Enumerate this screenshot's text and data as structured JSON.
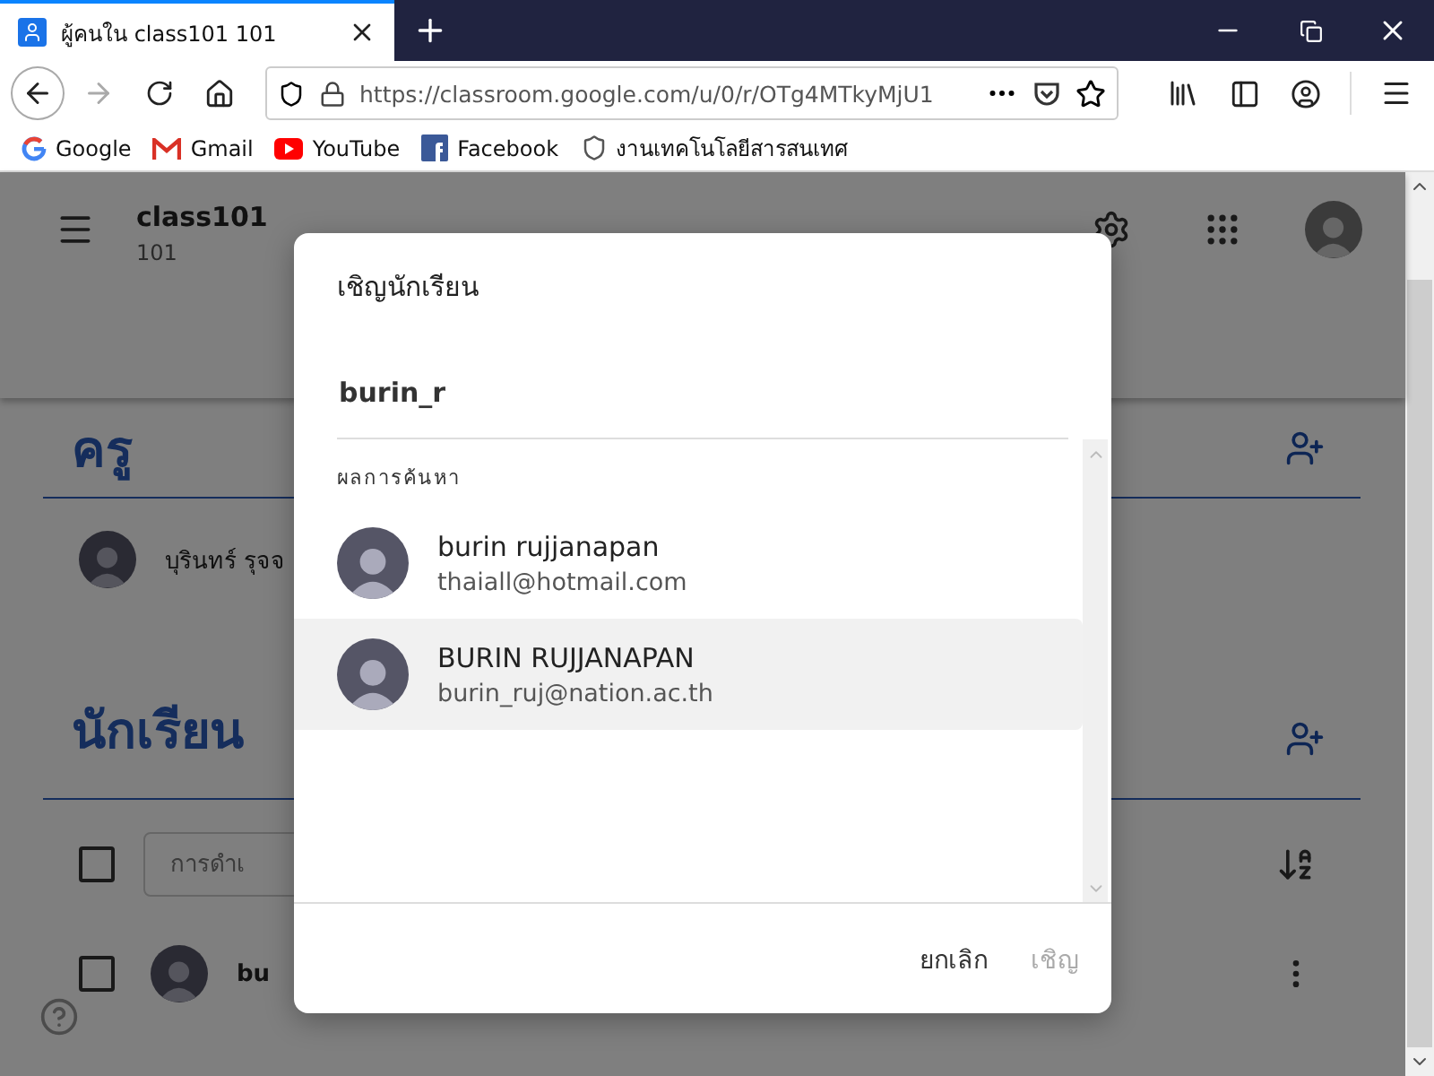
{
  "browser": {
    "tab": {
      "title": "ผู้คนใน class101 101",
      "selected": true
    },
    "url": "https://classroom.google.com/u/0/r/OTg4MTkyMjU1",
    "bookmarks": [
      {
        "label": "Google",
        "kind": "google"
      },
      {
        "label": "Gmail",
        "kind": "gmail"
      },
      {
        "label": "YouTube",
        "kind": "youtube"
      },
      {
        "label": "Facebook",
        "kind": "facebook"
      },
      {
        "label": "งานเทคโนโลยีสารสนเทศ",
        "kind": "shield"
      }
    ]
  },
  "page": {
    "class_name": "class101",
    "section": "101",
    "teachers": {
      "heading": "ครู",
      "people": [
        {
          "name": "บุรินทร์ รุจจ"
        }
      ]
    },
    "students": {
      "heading": "นักเรียน",
      "select_all": {
        "checked": false
      },
      "filter": {
        "placeholder": "การดำเ"
      },
      "people": [
        {
          "name": "bu",
          "checked": false
        }
      ]
    }
  },
  "dialog": {
    "title": "เชิญนักเรียน",
    "query": "burin_r",
    "results_label": "ผลการค้นหา",
    "results": [
      {
        "name": "burin rujjanapan",
        "email": "thaiall@hotmail.com",
        "selected": false
      },
      {
        "name": "BURIN RUJJANAPAN",
        "email": "burin_ruj@nation.ac.th",
        "selected": true
      }
    ],
    "buttons": [
      {
        "label": "ยกเลิก",
        "disabled": false
      },
      {
        "label": "เชิญ",
        "disabled": true
      }
    ]
  }
}
